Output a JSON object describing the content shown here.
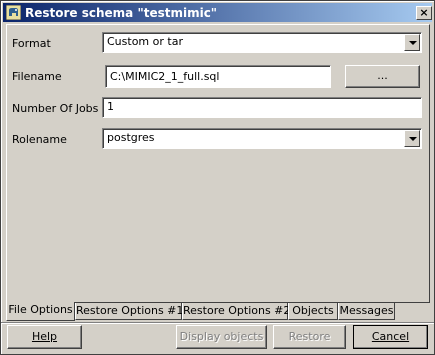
{
  "window": {
    "title": "Restore schema \"testmimic\"",
    "close_label": "×"
  },
  "form": {
    "format_label": "Format",
    "format_value": "Custom or tar",
    "filename_label": "Filename",
    "filename_value": "C:\\MIMIC2_1_full.sql",
    "browse_label": "...",
    "jobs_label": "Number Of Jobs",
    "jobs_value": "1",
    "rolename_label": "Rolename",
    "rolename_value": "postgres"
  },
  "tabs": [
    {
      "label": "File Options",
      "active": true
    },
    {
      "label": "Restore Options #1",
      "active": false
    },
    {
      "label": "Restore Options #2",
      "active": false
    },
    {
      "label": "Objects",
      "active": false
    },
    {
      "label": "Messages",
      "active": false
    }
  ],
  "buttons": {
    "help": "Help",
    "display_objects": "Display objects",
    "restore": "Restore",
    "cancel": "Cancel"
  }
}
